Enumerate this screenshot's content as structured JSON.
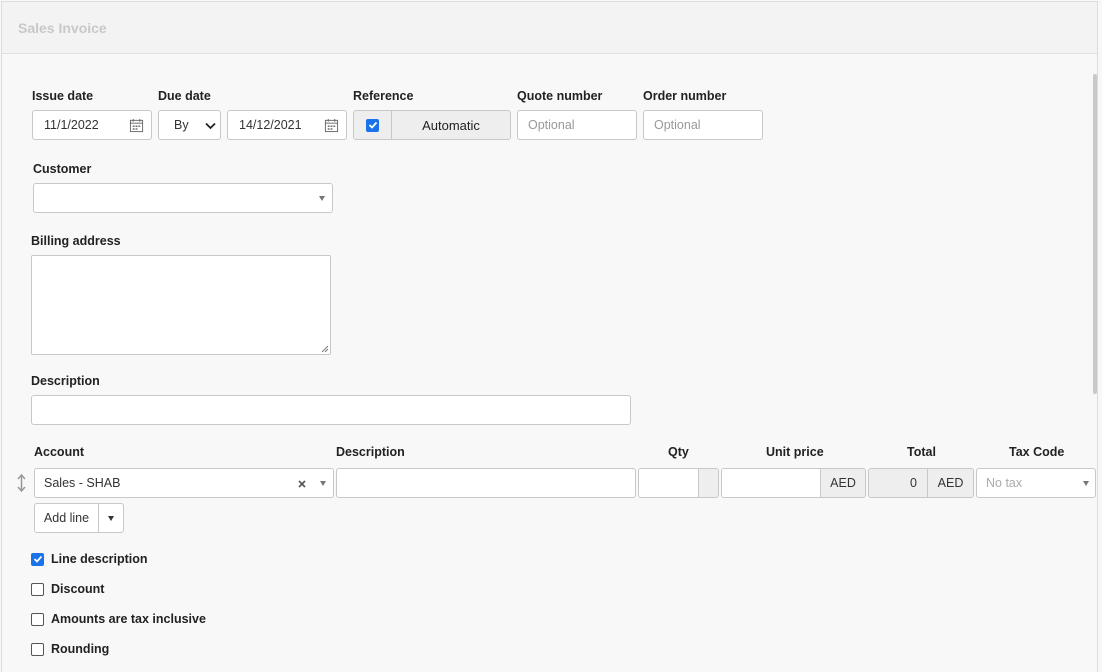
{
  "window": {
    "title": "Sales Invoice"
  },
  "form": {
    "issue_date": {
      "label": "Issue date",
      "value": "11/1/2022"
    },
    "due_date": {
      "label": "Due date",
      "mode": "By",
      "value": "14/12/2021"
    },
    "reference": {
      "label": "Reference",
      "checked": true,
      "value": "Automatic"
    },
    "quote_number": {
      "label": "Quote number",
      "placeholder": "Optional"
    },
    "order_number": {
      "label": "Order number",
      "placeholder": "Optional"
    },
    "customer": {
      "label": "Customer",
      "value": ""
    },
    "billing_address": {
      "label": "Billing address",
      "value": ""
    },
    "description": {
      "label": "Description",
      "value": ""
    }
  },
  "lines": {
    "headers": {
      "account": "Account",
      "description": "Description",
      "qty": "Qty",
      "unit_price": "Unit price",
      "total": "Total",
      "tax_code": "Tax Code"
    },
    "rows": [
      {
        "account": "Sales - SHAB",
        "description": "",
        "qty": "",
        "unit_price": "",
        "currency": "AED",
        "total": "0",
        "total_currency": "AED",
        "tax_code_placeholder": "No tax"
      }
    ],
    "add_line_label": "Add line"
  },
  "options": [
    {
      "label": "Line description",
      "checked": true
    },
    {
      "label": "Discount",
      "checked": false
    },
    {
      "label": "Amounts are tax inclusive",
      "checked": false
    },
    {
      "label": "Rounding",
      "checked": false
    }
  ],
  "colors": {
    "checkbox_accent": "#1a73e8",
    "title_text": "#c8c8c8"
  }
}
